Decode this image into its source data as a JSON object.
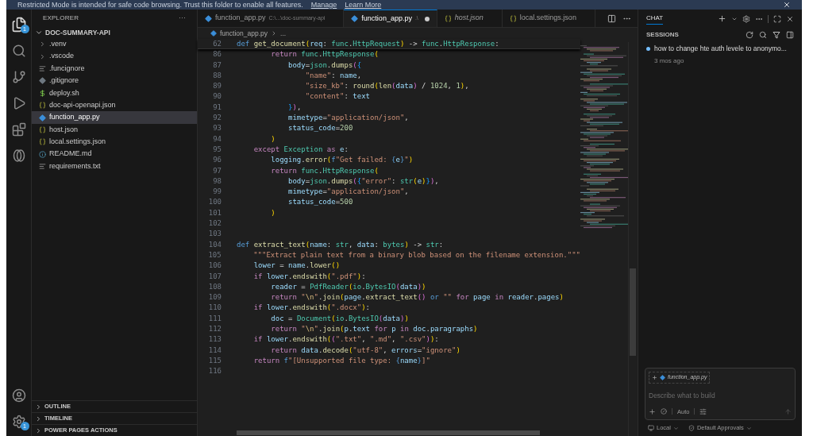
{
  "banner": {
    "text": "Restricted Mode is intended for safe code browsing. Trust this folder to enable all features.",
    "links": [
      "Manage",
      "Learn More"
    ]
  },
  "activity_bar": {
    "top": [
      {
        "kind": "files",
        "badge": "1"
      },
      {
        "kind": "search"
      },
      {
        "kind": "source-control"
      },
      {
        "kind": "run"
      },
      {
        "kind": "extensions"
      },
      {
        "kind": "rings"
      }
    ],
    "bottom": [
      {
        "kind": "account"
      },
      {
        "kind": "settings",
        "badge": "1"
      }
    ]
  },
  "explorer": {
    "title": "EXPLORER",
    "more": "···",
    "root": {
      "label": "DOC-SUMMARY-API",
      "expanded": true
    },
    "items": [
      {
        "label": ".venv",
        "kind": "folder",
        "selected": false
      },
      {
        "label": ".vscode",
        "kind": "folder",
        "selected": false
      },
      {
        "label": ".funcignore",
        "kind": "lines",
        "selected": false
      },
      {
        "label": ".gitignore",
        "kind": "git",
        "selected": false
      },
      {
        "label": "deploy.sh",
        "kind": "shell",
        "selected": false
      },
      {
        "label": "doc-api-openapi.json",
        "kind": "json",
        "selected": false
      },
      {
        "label": "function_app.py",
        "kind": "python",
        "selected": true
      },
      {
        "label": "host.json",
        "kind": "json",
        "selected": false
      },
      {
        "label": "local.settings.json",
        "kind": "json",
        "selected": false
      },
      {
        "label": "README.md",
        "kind": "info",
        "selected": false
      },
      {
        "label": "requirements.txt",
        "kind": "lines",
        "selected": false
      }
    ],
    "sections": [
      {
        "label": "OUTLINE",
        "expanded": false
      },
      {
        "label": "TIMELINE",
        "expanded": false
      },
      {
        "label": "POWER PAGES ACTIONS",
        "expanded": false
      }
    ]
  },
  "tabs": [
    {
      "label": "function_app.py",
      "description": "C:\\...\\doc-summary-api",
      "kind": "python",
      "selected": false,
      "modified": false,
      "preview": false
    },
    {
      "label": "function_app.py",
      "description": ".\\",
      "kind": "python",
      "selected": true,
      "modified": true,
      "preview": false
    },
    {
      "label": "host.json",
      "kind": "json",
      "selected": false,
      "modified": false,
      "preview": true
    },
    {
      "label": "local.settings.json",
      "kind": "json",
      "selected": false,
      "modified": false,
      "preview": false
    }
  ],
  "breadcrumb": [
    "function_app.py",
    "..."
  ],
  "sticky_line": {
    "n": "62",
    "code": [
      {
        "text": "def ",
        "kind": "def"
      },
      {
        "text": "get_document",
        "kind": "fn"
      },
      {
        "text": "(",
        "kind": "b1"
      },
      {
        "text": "req",
        "kind": "var"
      },
      {
        "text": ": ",
        "kind": "p"
      },
      {
        "text": "func",
        "kind": "cls"
      },
      {
        "text": ".",
        "kind": "p"
      },
      {
        "text": "HttpRequest",
        "kind": "cls"
      },
      {
        "text": ")",
        "kind": "b1"
      },
      {
        "text": " -> ",
        "kind": "p"
      },
      {
        "text": "func",
        "kind": "cls"
      },
      {
        "text": ".",
        "kind": "p"
      },
      {
        "text": "HttpResponse",
        "kind": "cls"
      },
      {
        "text": ":",
        "kind": "p"
      }
    ]
  },
  "lines": [
    {
      "n": "86",
      "code": [
        {
          "text": "        return ",
          "kind": "kw"
        },
        {
          "text": "func",
          "kind": "cls"
        },
        {
          "text": ".",
          "kind": "p"
        },
        {
          "text": "HttpResponse",
          "kind": "cls"
        },
        {
          "text": "(",
          "kind": "b1"
        }
      ]
    },
    {
      "n": "87",
      "code": [
        {
          "text": "            body",
          "kind": "var"
        },
        {
          "text": "=",
          "kind": "p"
        },
        {
          "text": "json",
          "kind": "cls"
        },
        {
          "text": ".",
          "kind": "p"
        },
        {
          "text": "dumps",
          "kind": "fn"
        },
        {
          "text": "(",
          "kind": "b2"
        },
        {
          "text": "{",
          "kind": "b3"
        }
      ]
    },
    {
      "n": "88",
      "code": [
        {
          "text": "                \"name\"",
          "kind": "str"
        },
        {
          "text": ": ",
          "kind": "p"
        },
        {
          "text": "name",
          "kind": "var"
        },
        {
          "text": ",",
          "kind": "p"
        }
      ]
    },
    {
      "n": "89",
      "code": [
        {
          "text": "                \"size_kb\"",
          "kind": "str"
        },
        {
          "text": ": ",
          "kind": "p"
        },
        {
          "text": "round",
          "kind": "fn"
        },
        {
          "text": "(",
          "kind": "b1"
        },
        {
          "text": "len",
          "kind": "fn"
        },
        {
          "text": "(",
          "kind": "b2"
        },
        {
          "text": "data",
          "kind": "var"
        },
        {
          "text": ")",
          "kind": "b2"
        },
        {
          "text": " / ",
          "kind": "p"
        },
        {
          "text": "1024",
          "kind": "num"
        },
        {
          "text": ", ",
          "kind": "p"
        },
        {
          "text": "1",
          "kind": "num"
        },
        {
          "text": ")",
          "kind": "b1"
        },
        {
          "text": ",",
          "kind": "p"
        }
      ]
    },
    {
      "n": "90",
      "code": [
        {
          "text": "                \"content\"",
          "kind": "str"
        },
        {
          "text": ": ",
          "kind": "p"
        },
        {
          "text": "text",
          "kind": "var"
        }
      ]
    },
    {
      "n": "91",
      "code": [
        {
          "text": "            }",
          "kind": "b3"
        },
        {
          "text": ")",
          "kind": "b2"
        },
        {
          "text": ",",
          "kind": "p"
        }
      ]
    },
    {
      "n": "92",
      "code": [
        {
          "text": "            mimetype",
          "kind": "var"
        },
        {
          "text": "=",
          "kind": "p"
        },
        {
          "text": "\"application/json\"",
          "kind": "str"
        },
        {
          "text": ",",
          "kind": "p"
        }
      ]
    },
    {
      "n": "93",
      "code": [
        {
          "text": "            status_code",
          "kind": "var"
        },
        {
          "text": "=",
          "kind": "p"
        },
        {
          "text": "200",
          "kind": "num"
        }
      ]
    },
    {
      "n": "94",
      "code": [
        {
          "text": "        )",
          "kind": "b1"
        }
      ]
    },
    {
      "n": "95",
      "code": [
        {
          "text": "    except ",
          "kind": "kw"
        },
        {
          "text": "Exception",
          "kind": "cls"
        },
        {
          "text": " as ",
          "kind": "kw"
        },
        {
          "text": "e",
          "kind": "var"
        },
        {
          "text": ":",
          "kind": "p"
        }
      ]
    },
    {
      "n": "96",
      "code": [
        {
          "text": "        logging",
          "kind": "var"
        },
        {
          "text": ".",
          "kind": "p"
        },
        {
          "text": "error",
          "kind": "fn"
        },
        {
          "text": "(",
          "kind": "b1"
        },
        {
          "text": "f",
          "kind": "def"
        },
        {
          "text": "\"Get failed: ",
          "kind": "str"
        },
        {
          "text": "{",
          "kind": "def"
        },
        {
          "text": "e",
          "kind": "var"
        },
        {
          "text": "}",
          "kind": "def"
        },
        {
          "text": "\"",
          "kind": "str"
        },
        {
          "text": ")",
          "kind": "b1"
        }
      ]
    },
    {
      "n": "97",
      "code": [
        {
          "text": "        return ",
          "kind": "kw"
        },
        {
          "text": "func",
          "kind": "cls"
        },
        {
          "text": ".",
          "kind": "p"
        },
        {
          "text": "HttpResponse",
          "kind": "cls"
        },
        {
          "text": "(",
          "kind": "b1"
        }
      ]
    },
    {
      "n": "98",
      "code": [
        {
          "text": "            body",
          "kind": "var"
        },
        {
          "text": "=",
          "kind": "p"
        },
        {
          "text": "json",
          "kind": "cls"
        },
        {
          "text": ".",
          "kind": "p"
        },
        {
          "text": "dumps",
          "kind": "fn"
        },
        {
          "text": "(",
          "kind": "b2"
        },
        {
          "text": "{",
          "kind": "b3"
        },
        {
          "text": "\"error\"",
          "kind": "str"
        },
        {
          "text": ": ",
          "kind": "p"
        },
        {
          "text": "str",
          "kind": "cls"
        },
        {
          "text": "(",
          "kind": "b1"
        },
        {
          "text": "e",
          "kind": "var"
        },
        {
          "text": ")",
          "kind": "b1"
        },
        {
          "text": "}",
          "kind": "b3"
        },
        {
          "text": ")",
          "kind": "b2"
        },
        {
          "text": ",",
          "kind": "p"
        }
      ]
    },
    {
      "n": "99",
      "code": [
        {
          "text": "            mimetype",
          "kind": "var"
        },
        {
          "text": "=",
          "kind": "p"
        },
        {
          "text": "\"application/json\"",
          "kind": "str"
        },
        {
          "text": ",",
          "kind": "p"
        }
      ]
    },
    {
      "n": "100",
      "code": [
        {
          "text": "            status_code",
          "kind": "var"
        },
        {
          "text": "=",
          "kind": "p"
        },
        {
          "text": "500",
          "kind": "num"
        }
      ]
    },
    {
      "n": "101",
      "code": [
        {
          "text": "        )",
          "kind": "b1"
        }
      ]
    },
    {
      "n": "102"
    },
    {
      "n": "103"
    },
    {
      "n": "104",
      "code": [
        {
          "text": "def ",
          "kind": "def"
        },
        {
          "text": "extract_text",
          "kind": "fn"
        },
        {
          "text": "(",
          "kind": "b1"
        },
        {
          "text": "name",
          "kind": "var"
        },
        {
          "text": ": ",
          "kind": "p"
        },
        {
          "text": "str",
          "kind": "cls"
        },
        {
          "text": ", ",
          "kind": "p"
        },
        {
          "text": "data",
          "kind": "var"
        },
        {
          "text": ": ",
          "kind": "p"
        },
        {
          "text": "bytes",
          "kind": "cls"
        },
        {
          "text": ")",
          "kind": "b1"
        },
        {
          "text": " -> ",
          "kind": "p"
        },
        {
          "text": "str",
          "kind": "cls"
        },
        {
          "text": ":",
          "kind": "p"
        }
      ]
    },
    {
      "n": "105",
      "code": [
        {
          "text": "    \"\"\"Extract plain text from a binary blob based on the filename extension.\"\"\"",
          "kind": "str"
        }
      ]
    },
    {
      "n": "106",
      "code": [
        {
          "text": "    lower",
          "kind": "var"
        },
        {
          "text": " = ",
          "kind": "p"
        },
        {
          "text": "name",
          "kind": "var"
        },
        {
          "text": ".",
          "kind": "p"
        },
        {
          "text": "lower",
          "kind": "fn"
        },
        {
          "text": "()",
          "kind": "b1"
        }
      ]
    },
    {
      "n": "107",
      "code": [
        {
          "text": "    if ",
          "kind": "kw"
        },
        {
          "text": "lower",
          "kind": "var"
        },
        {
          "text": ".",
          "kind": "p"
        },
        {
          "text": "endswith",
          "kind": "fn"
        },
        {
          "text": "(",
          "kind": "b1"
        },
        {
          "text": "\".pdf\"",
          "kind": "str"
        },
        {
          "text": ")",
          "kind": "b1"
        },
        {
          "text": ":",
          "kind": "p"
        }
      ]
    },
    {
      "n": "108",
      "code": [
        {
          "text": "        reader",
          "kind": "var"
        },
        {
          "text": " = ",
          "kind": "p"
        },
        {
          "text": "PdfReader",
          "kind": "cls"
        },
        {
          "text": "(",
          "kind": "b1"
        },
        {
          "text": "io",
          "kind": "cls"
        },
        {
          "text": ".",
          "kind": "p"
        },
        {
          "text": "BytesIO",
          "kind": "cls"
        },
        {
          "text": "(",
          "kind": "b2"
        },
        {
          "text": "data",
          "kind": "var"
        },
        {
          "text": ")",
          "kind": "b2"
        },
        {
          "text": ")",
          "kind": "b1"
        }
      ]
    },
    {
      "n": "109",
      "code": [
        {
          "text": "        return ",
          "kind": "kw"
        },
        {
          "text": "\"",
          "kind": "str"
        },
        {
          "text": "\\n",
          "kind": "esc"
        },
        {
          "text": "\"",
          "kind": "str"
        },
        {
          "text": ".",
          "kind": "p"
        },
        {
          "text": "join",
          "kind": "fn"
        },
        {
          "text": "(",
          "kind": "b1"
        },
        {
          "text": "page",
          "kind": "var"
        },
        {
          "text": ".",
          "kind": "p"
        },
        {
          "text": "extract_text",
          "kind": "fn"
        },
        {
          "text": "()",
          "kind": "b2"
        },
        {
          "text": " or ",
          "kind": "def"
        },
        {
          "text": "\"\"",
          "kind": "str"
        },
        {
          "text": " for ",
          "kind": "kw"
        },
        {
          "text": "page",
          "kind": "var"
        },
        {
          "text": " in ",
          "kind": "kw"
        },
        {
          "text": "reader",
          "kind": "var"
        },
        {
          "text": ".",
          "kind": "p"
        },
        {
          "text": "pages",
          "kind": "var"
        },
        {
          "text": ")",
          "kind": "b1"
        }
      ]
    },
    {
      "n": "110",
      "code": [
        {
          "text": "    if ",
          "kind": "kw"
        },
        {
          "text": "lower",
          "kind": "var"
        },
        {
          "text": ".",
          "kind": "p"
        },
        {
          "text": "endswith",
          "kind": "fn"
        },
        {
          "text": "(",
          "kind": "b1"
        },
        {
          "text": "\".docx\"",
          "kind": "str"
        },
        {
          "text": ")",
          "kind": "b1"
        },
        {
          "text": ":",
          "kind": "p"
        }
      ]
    },
    {
      "n": "111",
      "code": [
        {
          "text": "        doc",
          "kind": "var"
        },
        {
          "text": " = ",
          "kind": "p"
        },
        {
          "text": "Document",
          "kind": "cls"
        },
        {
          "text": "(",
          "kind": "b1"
        },
        {
          "text": "io",
          "kind": "cls"
        },
        {
          "text": ".",
          "kind": "p"
        },
        {
          "text": "BytesIO",
          "kind": "cls"
        },
        {
          "text": "(",
          "kind": "b2"
        },
        {
          "text": "data",
          "kind": "var"
        },
        {
          "text": ")",
          "kind": "b2"
        },
        {
          "text": ")",
          "kind": "b1"
        }
      ]
    },
    {
      "n": "112",
      "code": [
        {
          "text": "        return ",
          "kind": "kw"
        },
        {
          "text": "\"",
          "kind": "str"
        },
        {
          "text": "\\n",
          "kind": "esc"
        },
        {
          "text": "\"",
          "kind": "str"
        },
        {
          "text": ".",
          "kind": "p"
        },
        {
          "text": "join",
          "kind": "fn"
        },
        {
          "text": "(",
          "kind": "b1"
        },
        {
          "text": "p",
          "kind": "var"
        },
        {
          "text": ".",
          "kind": "p"
        },
        {
          "text": "text",
          "kind": "var"
        },
        {
          "text": " for ",
          "kind": "kw"
        },
        {
          "text": "p",
          "kind": "var"
        },
        {
          "text": " in ",
          "kind": "kw"
        },
        {
          "text": "doc",
          "kind": "var"
        },
        {
          "text": ".",
          "kind": "p"
        },
        {
          "text": "paragraphs",
          "kind": "var"
        },
        {
          "text": ")",
          "kind": "b1"
        }
      ]
    },
    {
      "n": "113",
      "code": [
        {
          "text": "    if ",
          "kind": "kw"
        },
        {
          "text": "lower",
          "kind": "var"
        },
        {
          "text": ".",
          "kind": "p"
        },
        {
          "text": "endswith",
          "kind": "fn"
        },
        {
          "text": "(",
          "kind": "b1"
        },
        {
          "text": "(",
          "kind": "b2"
        },
        {
          "text": "\".txt\"",
          "kind": "str"
        },
        {
          "text": ", ",
          "kind": "p"
        },
        {
          "text": "\".md\"",
          "kind": "str"
        },
        {
          "text": ", ",
          "kind": "p"
        },
        {
          "text": "\".csv\"",
          "kind": "str"
        },
        {
          "text": ")",
          "kind": "b2"
        },
        {
          "text": ")",
          "kind": "b1"
        },
        {
          "text": ":",
          "kind": "p"
        }
      ]
    },
    {
      "n": "114",
      "code": [
        {
          "text": "        return ",
          "kind": "kw"
        },
        {
          "text": "data",
          "kind": "var"
        },
        {
          "text": ".",
          "kind": "p"
        },
        {
          "text": "decode",
          "kind": "fn"
        },
        {
          "text": "(",
          "kind": "b1"
        },
        {
          "text": "\"utf-8\"",
          "kind": "str"
        },
        {
          "text": ", ",
          "kind": "p"
        },
        {
          "text": "errors",
          "kind": "var"
        },
        {
          "text": "=",
          "kind": "p"
        },
        {
          "text": "\"ignore\"",
          "kind": "str"
        },
        {
          "text": ")",
          "kind": "b1"
        }
      ]
    },
    {
      "n": "115",
      "code": [
        {
          "text": "    return ",
          "kind": "kw"
        },
        {
          "text": "f",
          "kind": "def"
        },
        {
          "text": "\"[Unsupported file type: ",
          "kind": "str"
        },
        {
          "text": "{",
          "kind": "def"
        },
        {
          "text": "name",
          "kind": "var"
        },
        {
          "text": "}",
          "kind": "def"
        },
        {
          "text": "]\"",
          "kind": "str"
        }
      ]
    },
    {
      "n": "116"
    }
  ],
  "chat": {
    "title": "CHAT",
    "sessions_title": "SESSIONS",
    "sessions": [
      {
        "title": "how to change hte auth levele to anonymo...",
        "time": "3 mos ago",
        "unread": true
      }
    ],
    "context_chip": "function_app.py",
    "placeholder": "Describe what to build",
    "mode": "Auto",
    "footer": [
      "Local",
      "Default Approvals"
    ]
  }
}
